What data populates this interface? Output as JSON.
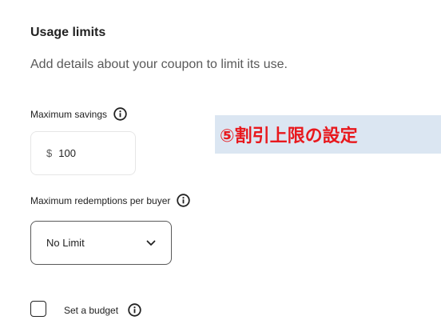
{
  "section": {
    "title": "Usage limits",
    "description": "Add details about your coupon to limit its use."
  },
  "max_savings": {
    "label": "Maximum savings",
    "currency": "$",
    "value": "100",
    "info_icon": "info-circle-icon"
  },
  "max_redemptions": {
    "label": "Maximum redemptions per buyer",
    "selected": "No Limit",
    "info_icon": "info-circle-icon",
    "dropdown_icon": "chevron-down-icon"
  },
  "budget": {
    "label": "Set a budget",
    "checked": false,
    "info_icon": "info-circle-icon"
  },
  "annotation": {
    "text": "⑤割引上限の設定",
    "color": "#e8181d",
    "background": "#dbe6f2"
  }
}
